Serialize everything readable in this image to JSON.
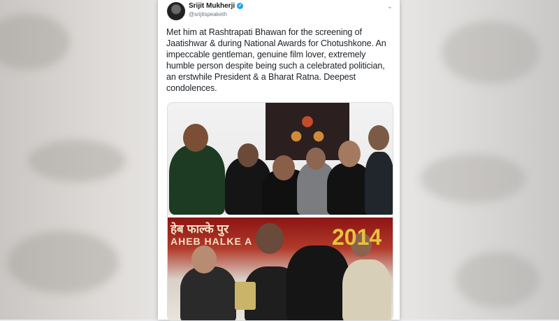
{
  "tweet": {
    "author_name": "Srijit Mukherji",
    "handle": "@srijitspeaketh",
    "text": "Met him at Rashtrapati Bhawan for the screening of Jaatishwar & during National Awards for Chotushkone. An impeccable gentleman, genuine film lover, extremely humble person despite being such a celebrated politician, an erstwhile President & a Bharat Ratna. Deepest condolences.",
    "verified_icon": "✓",
    "menu_icon": "⌄"
  },
  "photo_bottom": {
    "hindi_banner": "हेब फाल्के पुर",
    "english_banner": "AHEB  HALKE  A",
    "year": "2014"
  },
  "colors": {
    "accent": "#1da1f2",
    "text": "#1c2126",
    "handle": "#657786",
    "banner_red": "#8c1414"
  }
}
